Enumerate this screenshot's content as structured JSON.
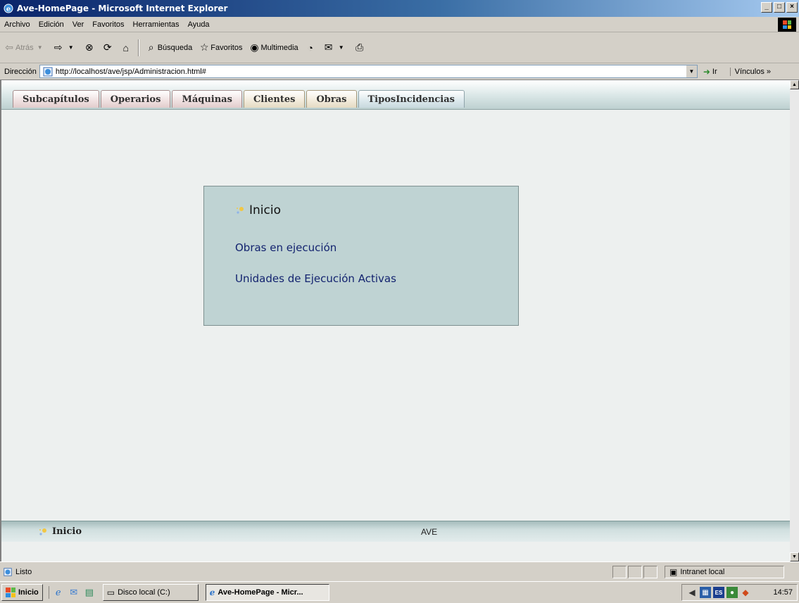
{
  "window": {
    "title": "Ave-HomePage - Microsoft Internet Explorer",
    "controls": [
      "_",
      "□",
      "×"
    ]
  },
  "menubar": {
    "items": [
      "Archivo",
      "Edición",
      "Ver",
      "Favoritos",
      "Herramientas",
      "Ayuda"
    ]
  },
  "toolbar": {
    "back_label": "Atrás",
    "search_label": "Búsqueda",
    "favorites_label": "Favoritos",
    "multimedia_label": "Multimedia"
  },
  "addressbar": {
    "label": "Dirección",
    "url": "http://localhost/ave/jsp/Administracion.html#",
    "go_label": "Ir",
    "links_label": "Vínculos"
  },
  "tabs": [
    "Subcapítulos",
    "Operarios",
    "Máquinas",
    "Clientes",
    "Obras",
    "TiposIncidencias"
  ],
  "panel": {
    "title": "Inicio",
    "links": [
      "Obras en ejecución",
      "Unidades de Ejecución Activas"
    ]
  },
  "footer": {
    "home_label": "Inicio",
    "center_text": "AVE"
  },
  "statusbar": {
    "status": "Listo",
    "zone": "Intranet local"
  },
  "taskbar": {
    "start_label": "Inicio",
    "tasks": [
      "Disco local (C:)",
      "Ave-HomePage - Micr..."
    ],
    "tray_lang": "ES",
    "clock": "14:57"
  },
  "colors": {
    "panel_bg": "#bfd3d3",
    "link": "#13236f",
    "content_bg": "#edf0ef",
    "titlebar": "#0a246a"
  },
  "icons": {
    "app": "ie-icon",
    "home": "sparkle-icon"
  }
}
